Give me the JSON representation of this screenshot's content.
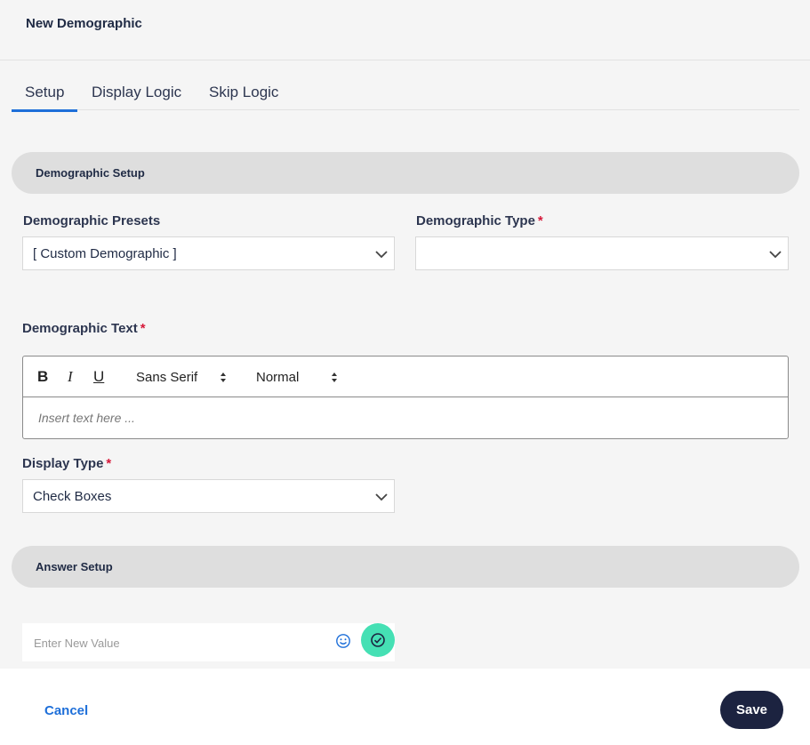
{
  "header": {
    "title": "New Demographic"
  },
  "tabs": [
    {
      "label": "Setup",
      "active": true
    },
    {
      "label": "Display Logic",
      "active": false
    },
    {
      "label": "Skip Logic",
      "active": false
    }
  ],
  "demographic_setup": {
    "section_title": "Demographic Setup",
    "presets_label": "Demographic Presets",
    "presets_value": "[ Custom Demographic ]",
    "type_label": "Demographic Type",
    "type_value": "",
    "required_mark": "*",
    "text_label": "Demographic Text",
    "editor": {
      "bold": "B",
      "italic": "I",
      "underline": "U",
      "font": "Sans Serif",
      "size": "Normal",
      "placeholder": "Insert text here ..."
    },
    "display_type_label": "Display Type",
    "display_type_value": "Check Boxes"
  },
  "answer_setup": {
    "section_title": "Answer Setup",
    "input_placeholder": "Enter New Value"
  },
  "footer": {
    "cancel_label": "Cancel",
    "save_label": "Save"
  },
  "colors": {
    "accent": "#1e6fd9",
    "confirm": "#45e0b4",
    "save_bg": "#1c2340",
    "required": "#d6193a"
  },
  "icons": [
    "chevron-down-icon",
    "updown-arrows-icon",
    "smiley-icon",
    "check-circle-icon"
  ]
}
